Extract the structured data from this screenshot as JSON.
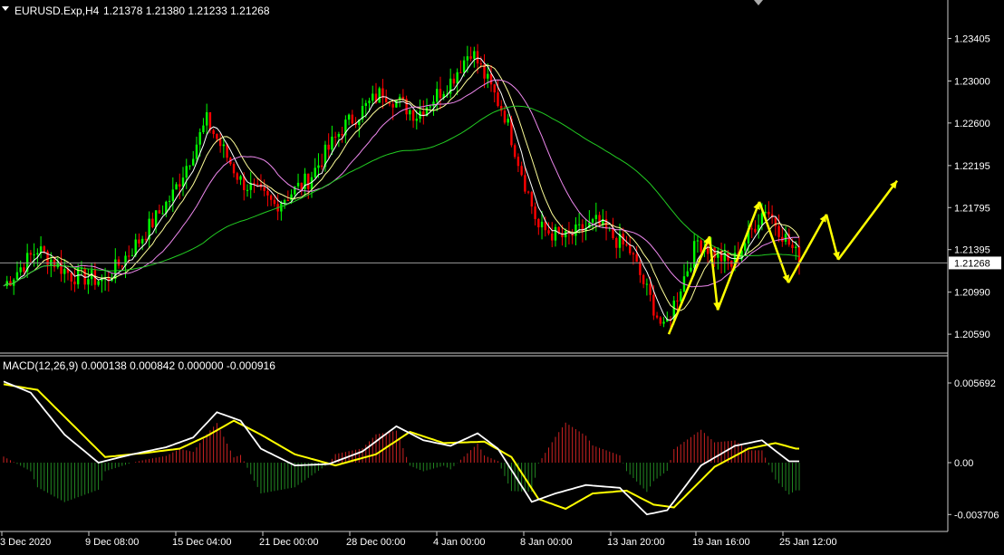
{
  "header": {
    "symbol": "EURUSD.Exp,H4",
    "ohlc": "1.21378 1.21380 1.21233 1.21268"
  },
  "macd_header": {
    "label": "MACD(12,26,9) 0.000138 0.000842 0.000000 -0.000916"
  },
  "colors": {
    "background": "#000000",
    "bull_candle": "#00ff00",
    "bear_candle": "#ff0000",
    "ma_fast": "#ffffff",
    "ma_medium": "#ffff99",
    "ma_slow": "#ee88ee",
    "ma_long": "#22cc22",
    "forecast_arrows": "#ffff00",
    "macd_line": "#ffffff",
    "signal_line": "#ffff00",
    "hist_positive": "#cc2222",
    "hist_negative": "#228822",
    "current_price_label_bg": "#ffffff",
    "current_price_label_text": "#000000",
    "grid_frame": "#cccccc"
  },
  "chart_data": [
    {
      "type": "candlestick",
      "instrument": "EURUSD.Exp",
      "timeframe": "H4",
      "price_axis_ticks": [
        "1.23405",
        "1.23000",
        "1.22600",
        "1.22195",
        "1.21795",
        "1.21395",
        "1.20990",
        "1.20590"
      ],
      "price_axis_values": [
        1.23405,
        1.23,
        1.226,
        1.22195,
        1.21795,
        1.21395,
        1.2099,
        1.2059
      ],
      "ylim": [
        1.2041,
        1.2365
      ],
      "current_price": 1.21268,
      "current_price_label": "1.21268",
      "time_axis_labels": [
        "3 Dec 2020",
        "9 Dec 08:00",
        "15 Dec 04:00",
        "21 Dec 00:00",
        "28 Dec 00:00",
        "4 Jan 00:00",
        "8 Jan 00:00",
        "13 Jan 20:00",
        "19 Jan 16:00",
        "25 Jan 12:00"
      ],
      "close_path": [
        {
          "bar": 0,
          "close": 1.2105
        },
        {
          "bar": 10,
          "close": 1.214
        },
        {
          "bar": 20,
          "close": 1.2115
        },
        {
          "bar": 30,
          "close": 1.211
        },
        {
          "bar": 40,
          "close": 1.2148
        },
        {
          "bar": 50,
          "close": 1.2192
        },
        {
          "bar": 60,
          "close": 1.2262
        },
        {
          "bar": 70,
          "close": 1.2205
        },
        {
          "bar": 80,
          "close": 1.2182
        },
        {
          "bar": 90,
          "close": 1.2206
        },
        {
          "bar": 100,
          "close": 1.2255
        },
        {
          "bar": 112,
          "close": 1.229
        },
        {
          "bar": 122,
          "close": 1.2268
        },
        {
          "bar": 132,
          "close": 1.23
        },
        {
          "bar": 138,
          "close": 1.233
        },
        {
          "bar": 148,
          "close": 1.2268
        },
        {
          "bar": 158,
          "close": 1.216
        },
        {
          "bar": 166,
          "close": 1.215
        },
        {
          "bar": 175,
          "close": 1.2165
        },
        {
          "bar": 185,
          "close": 1.2138
        },
        {
          "bar": 195,
          "close": 1.2062
        },
        {
          "bar": 205,
          "close": 1.2148
        },
        {
          "bar": 215,
          "close": 1.2125
        },
        {
          "bar": 225,
          "close": 1.218
        },
        {
          "bar": 235,
          "close": 1.213
        }
      ],
      "forecast_arrows": [
        {
          "from": 1.2059,
          "to": 1.2152
        },
        {
          "from": 1.2152,
          "to": 1.2082
        },
        {
          "from": 1.2082,
          "to": 1.2185
        },
        {
          "from": 1.2185,
          "to": 1.2108
        },
        {
          "from": 1.2108,
          "to": 1.2173
        },
        {
          "from": 1.2173,
          "to": 1.213
        },
        {
          "from": 1.213,
          "to": 1.2205
        }
      ]
    },
    {
      "type": "line",
      "indicator": "MACD",
      "params": [
        12,
        26,
        9
      ],
      "axis_ticks": [
        "0.005692",
        "0.00",
        "-0.003706"
      ],
      "axis_values": [
        0.005692,
        0.0,
        -0.003706
      ],
      "series": [
        {
          "name": "MACD",
          "points": [
            [
              0,
              0.0058
            ],
            [
              8,
              0.005
            ],
            [
              18,
              0.002
            ],
            [
              28,
              0.0
            ],
            [
              38,
              0.0006
            ],
            [
              48,
              0.0011
            ],
            [
              56,
              0.0018
            ],
            [
              63,
              0.0036
            ],
            [
              70,
              0.003
            ],
            [
              76,
              0.001
            ],
            [
              86,
              -0.0002
            ],
            [
              96,
              -0.0001
            ],
            [
              106,
              0.0008
            ],
            [
              116,
              0.0026
            ],
            [
              124,
              0.0016
            ],
            [
              132,
              0.0012
            ],
            [
              140,
              0.0021
            ],
            [
              146,
              0.001
            ],
            [
              156,
              -0.0028
            ],
            [
              163,
              -0.0022
            ],
            [
              172,
              -0.0016
            ],
            [
              182,
              -0.0018
            ],
            [
              190,
              -0.0037
            ],
            [
              196,
              -0.0034
            ],
            [
              206,
              -0.0002
            ],
            [
              216,
              0.0012
            ],
            [
              224,
              0.0016
            ],
            [
              232,
              0.0001
            ]
          ]
        },
        {
          "name": "Signal",
          "points": [
            [
              0,
              0.0056
            ],
            [
              10,
              0.0052
            ],
            [
              20,
              0.0028
            ],
            [
              30,
              0.0004
            ],
            [
              42,
              0.0007
            ],
            [
              52,
              0.001
            ],
            [
              60,
              0.0019
            ],
            [
              68,
              0.003
            ],
            [
              76,
              0.002
            ],
            [
              86,
              0.0006
            ],
            [
              98,
              -0.0002
            ],
            [
              110,
              0.0006
            ],
            [
              120,
              0.0022
            ],
            [
              130,
              0.0014
            ],
            [
              142,
              0.0015
            ],
            [
              150,
              0.0004
            ],
            [
              158,
              -0.0026
            ],
            [
              166,
              -0.0033
            ],
            [
              174,
              -0.0022
            ],
            [
              184,
              -0.002
            ],
            [
              192,
              -0.003
            ],
            [
              198,
              -0.0032
            ],
            [
              210,
              -0.0003
            ],
            [
              220,
              0.001
            ],
            [
              228,
              0.0014
            ],
            [
              234,
              0.001
            ]
          ]
        }
      ]
    }
  ]
}
